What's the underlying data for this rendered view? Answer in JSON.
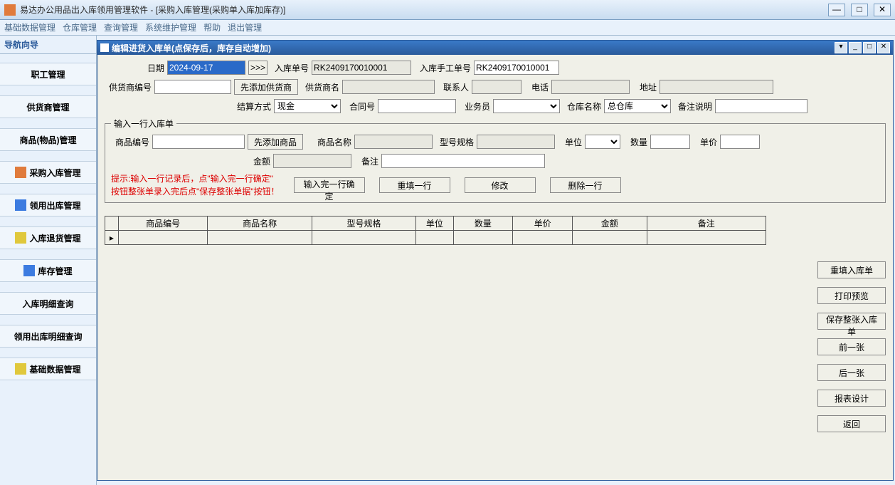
{
  "titlebar": {
    "app_name": "易达办公用品出入库领用管理软件",
    "doc_title": " - [采购入库管理(采购单入库加库存)]"
  },
  "menubar": {
    "items": [
      "基础数据管理",
      "仓库管理",
      "查询管理",
      "系统维护管理",
      "帮助",
      "退出管理"
    ]
  },
  "sidebar": {
    "header": "导航向导",
    "items": [
      {
        "label": "职工管理"
      },
      {
        "label": "供货商管理"
      },
      {
        "label": "商品(物品)管理"
      },
      {
        "label": "采购入库管理"
      },
      {
        "label": "领用出库管理"
      },
      {
        "label": "入库退货管理"
      },
      {
        "label": "库存管理"
      },
      {
        "label": "入库明细查询"
      },
      {
        "label": "领用出库明细查询"
      },
      {
        "label": "基础数据管理"
      }
    ]
  },
  "subwin": {
    "title": "编辑进货入库单(点保存后，库存自动增加)"
  },
  "form": {
    "date_label": "日期",
    "date_value": "2024-09-17",
    "date_btn": ">>>",
    "inno_label": "入库单号",
    "inno_value": "RK2409170010001",
    "manual_label": "入库手工单号",
    "manual_value": "RK2409170010001",
    "supplier_code_label": "供货商编号",
    "add_supplier_btn": "先添加供货商",
    "supplier_name_label": "供货商名",
    "contact_label": "联系人",
    "phone_label": "电话",
    "address_label": "地址",
    "paymethod_label": "结算方式",
    "paymethod_value": "现金",
    "contract_label": "合同号",
    "clerk_label": "业务员",
    "warehouse_label": "仓库名称",
    "warehouse_value": "总仓库",
    "remark_header_label": "备注说明"
  },
  "line": {
    "legend": "输入一行入库单",
    "pcode_label": "商品编号",
    "add_product_btn": "先添加商品",
    "pname_label": "商品名称",
    "spec_label": "型号规格",
    "unit_label": "单位",
    "qty_label": "数量",
    "price_label": "单价",
    "amount_label": "金额",
    "remark_label": "备注"
  },
  "hints": {
    "line1": "提示:输入一行记录后，点\"输入完一行确定\"",
    "line2": "按钮整张单录入完后点\"保存整张单据\"按钮！"
  },
  "row_actions": {
    "confirm": "输入完一行确定",
    "refill": "重填一行",
    "edit": "修改",
    "delete": "删除一行"
  },
  "table": {
    "headers": [
      "商品编号",
      "商品名称",
      "型号规格",
      "单位",
      "数量",
      "单价",
      "金额",
      "备注"
    ]
  },
  "right_buttons": {
    "b1": "重填入库单",
    "b2": "打印预览",
    "b3": "保存整张入库单",
    "b4": "前一张",
    "b5": "后一张",
    "b6": "报表设计",
    "b7": "返回"
  }
}
